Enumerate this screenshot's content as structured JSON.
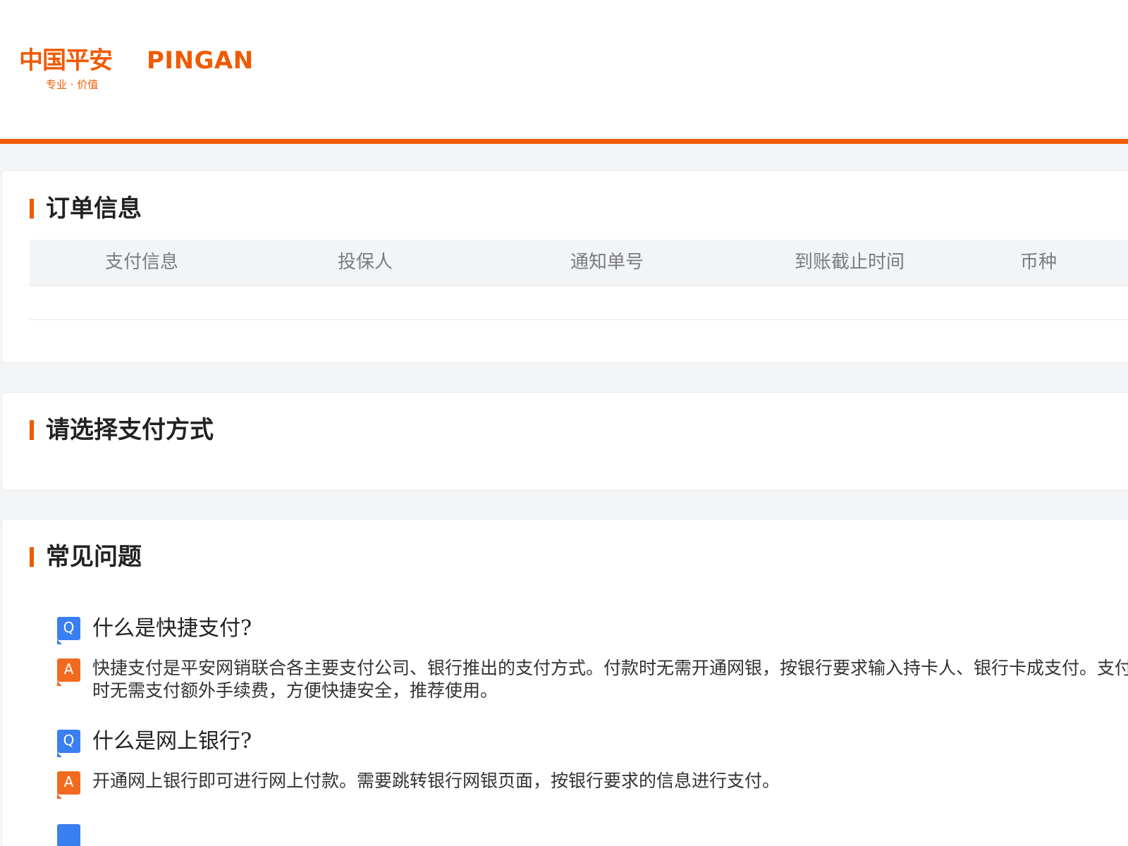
{
  "header": {
    "logo_cn": "中国平安",
    "logo_en": "PINGAN",
    "logo_tagline": "专业 · 价值",
    "brand_color": "#f05a00"
  },
  "order": {
    "title": "订单信息",
    "columns": [
      "支付信息",
      "投保人",
      "通知单号",
      "到账截止时间",
      "币种"
    ],
    "rows": []
  },
  "payment": {
    "title": "请选择支付方式"
  },
  "faq": {
    "title": "常见问题",
    "q_badge": "Q",
    "a_badge": "A",
    "items": [
      {
        "question": "什么是快捷支付?",
        "answer": "快捷支付是平安网销联合各主要支付公司、银行推出的支付方式。付款时无需开通网银，按银行要求输入持卡人、银行卡成支付。支付时无需支付额外手续费，方便快捷安全，推荐使用。"
      },
      {
        "question": "什么是网上银行?",
        "answer": "开通网上银行即可进行网上付款。需要跳转银行网银页面，按银行要求的信息进行支付。"
      }
    ]
  }
}
